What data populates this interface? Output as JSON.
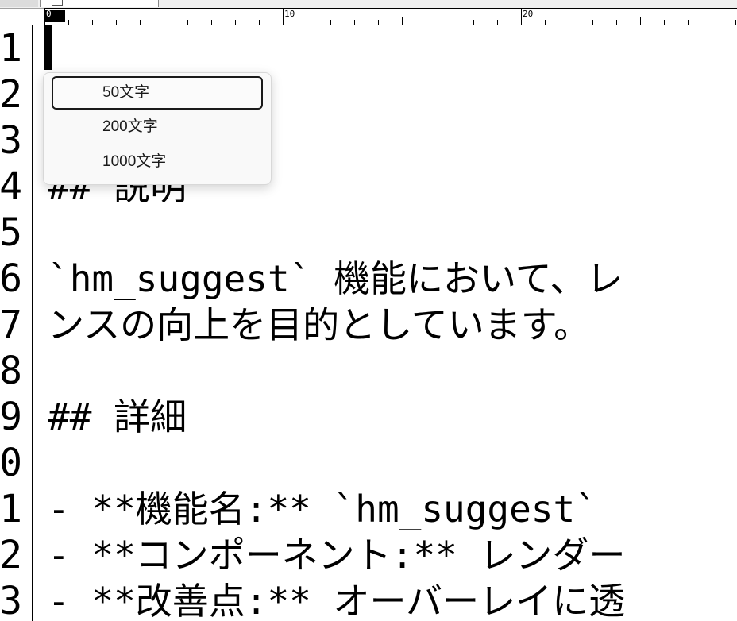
{
  "ruler": {
    "cursor_label": "0",
    "labels": [
      "10",
      "20"
    ]
  },
  "gutter": {
    "line_numbers": [
      "1",
      "2",
      "3",
      "4",
      "5",
      "6",
      "7",
      "8",
      "9",
      "0",
      "1",
      "2",
      "3"
    ]
  },
  "editor": {
    "lines": [
      "",
      "",
      "",
      "## 説明",
      "",
      "`hm_suggest` 機能において、レ",
      "ンスの向上を目的としています。",
      "",
      "## 詳細",
      "",
      "- **機能名:** `hm_suggest`",
      "- **コンポーネント:** レンダー",
      "- **改善点:** オーバーレイに透"
    ]
  },
  "suggest_popup": {
    "items": [
      {
        "label": "50文字",
        "selected": true
      },
      {
        "label": "200文字",
        "selected": false
      },
      {
        "label": "1000文字",
        "selected": false
      }
    ]
  }
}
